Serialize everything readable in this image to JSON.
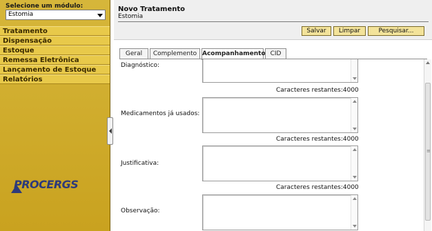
{
  "sidebar": {
    "module_label": "Selecione um módulo:",
    "module_selected": "Estomia",
    "menu": [
      {
        "label": "Tratamento"
      },
      {
        "label": "Dispensação"
      },
      {
        "label": "Estoque"
      },
      {
        "label": "Remessa Eletrônica"
      },
      {
        "label": "Lançamento de Estoque"
      },
      {
        "label": "Relatórios"
      }
    ],
    "logo_text": "PROCERGS"
  },
  "header": {
    "title": "Novo Tratamento",
    "subtitle": "Estomia",
    "buttons": {
      "save": "Salvar",
      "clear": "Limpar",
      "search": "Pesquisar..."
    }
  },
  "tabs": [
    {
      "label": "Geral",
      "active": false
    },
    {
      "label": "Complemento",
      "active": false
    },
    {
      "label": "Acompanhamento",
      "active": true
    },
    {
      "label": "CID",
      "active": false
    }
  ],
  "fields": [
    {
      "label": "Diagnóstico:",
      "value": "",
      "counter": "Caracteres restantes:4000"
    },
    {
      "label": "Medicamentos já usados:",
      "value": "",
      "counter": "Caracteres restantes:4000"
    },
    {
      "label": "Justificativa:",
      "value": "",
      "counter": "Caracteres restantes:4000"
    },
    {
      "label": "Observação:",
      "value": "",
      "counter": ""
    }
  ],
  "colors": {
    "sidebar_bg": "#c9a21f",
    "menu_item_bg": "#e8c94a",
    "button_bg": "#f3e39a",
    "logo": "#2d3a7a"
  }
}
